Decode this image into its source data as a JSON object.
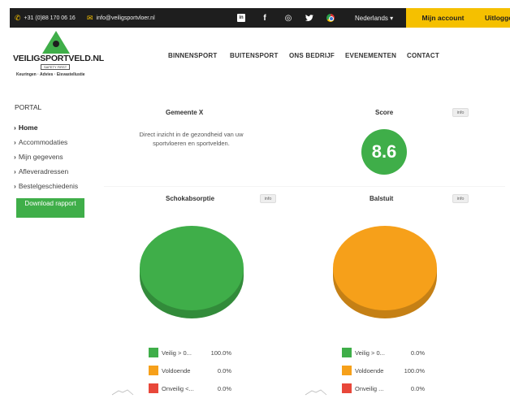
{
  "topbar": {
    "phone": "+31 (0)88 170 06 16",
    "email": "info@veiligsportvloer.nl",
    "social_icons": [
      "linkedin-icon",
      "facebook-icon",
      "instagram-icon",
      "twitter-icon",
      "chrome-icon"
    ],
    "linkedin_glyph": "in",
    "facebook_glyph": "f",
    "instagram_glyph": "◎",
    "twitter_glyph": "🐦",
    "language": "Nederlands ▾",
    "my_account": "Mijn account",
    "logout": "Uitloggen"
  },
  "logo": {
    "name": "VEILIGSPORTVELD.NL",
    "subtitle": "SAFETY FIRST",
    "tagline": "Keuringen · Advies · Eisvastellustie"
  },
  "nav": [
    "BINNENSPORT",
    "BUITENSPORT",
    "ONS BEDRIJF",
    "EVENEMENTEN",
    "CONTACT"
  ],
  "sidebar": {
    "title": "PORTAL",
    "items": [
      {
        "label": "Home",
        "active": true
      },
      {
        "label": "Accommodaties",
        "active": false
      },
      {
        "label": "Mijn gegevens",
        "active": false
      },
      {
        "label": "Afleveradressen",
        "active": false
      },
      {
        "label": "Bestelgeschiedenis",
        "active": false
      }
    ],
    "download_label": "Download rapport"
  },
  "panels": {
    "gemeente": {
      "title": "Gemeente X",
      "description": "Direct inzicht in de gezondheid van uw sportvloeren en sportvelden."
    },
    "score": {
      "title": "Score",
      "value": "8.6",
      "info_label": "info"
    },
    "schok": {
      "title": "Schokabsorptie",
      "info_label": "info"
    },
    "bal": {
      "title": "Balstuit",
      "info_label": "info"
    }
  },
  "colors": {
    "green": "#3fae49",
    "orange": "#f6a01a",
    "red": "#e8473a",
    "brand_yellow": "#f5c000"
  },
  "chart_data": [
    {
      "type": "pie",
      "title": "Schokabsorptie",
      "categories": [
        "Veilig > 0...",
        "Voldoende",
        "Onveilig <..."
      ],
      "values": [
        100.0,
        0.0,
        0.0
      ],
      "value_labels": [
        "100.0%",
        "0.0%",
        "0.0%"
      ],
      "colors": [
        "#3fae49",
        "#f6a01a",
        "#e8473a"
      ]
    },
    {
      "type": "pie",
      "title": "Balstuit",
      "categories": [
        "Veilig > 0...",
        "Voldoende",
        "Onveilig ..."
      ],
      "values": [
        0.0,
        100.0,
        0.0
      ],
      "value_labels": [
        "0.0%",
        "100.0%",
        "0.0%"
      ],
      "colors": [
        "#3fae49",
        "#f6a01a",
        "#e8473a"
      ]
    }
  ]
}
